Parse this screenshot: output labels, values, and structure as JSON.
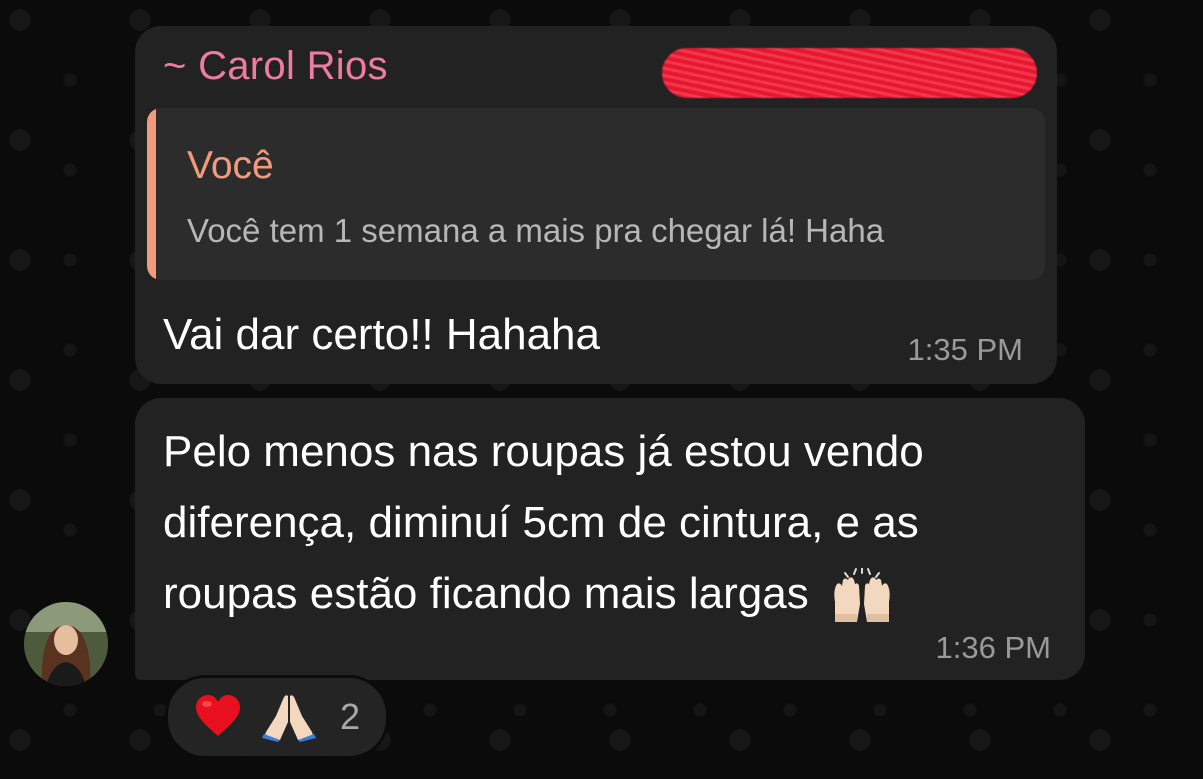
{
  "message_1": {
    "sender": "~ Carol Rios",
    "reply": {
      "author": "Você",
      "text": "Você tem 1 semana a mais pra chegar lá! Haha"
    },
    "text": "Vai dar certo!! Hahaha",
    "time": "1:35 PM"
  },
  "message_2": {
    "text": "Pelo menos nas roupas já estou vendo diferença, diminuí 5cm de cintura, e as roupas estão ficando mais largas",
    "emoji_icon": "raising-hands-icon",
    "time": "1:36 PM"
  },
  "reactions": {
    "icons": [
      "red-heart-icon",
      "folded-hands-icon"
    ],
    "count": "2"
  },
  "colors": {
    "background": "#0b0b0b",
    "bubble": "#222222",
    "sender_name": "#ef7ba0",
    "reply_accent": "#f39a7c",
    "redaction": "#e5162f"
  }
}
